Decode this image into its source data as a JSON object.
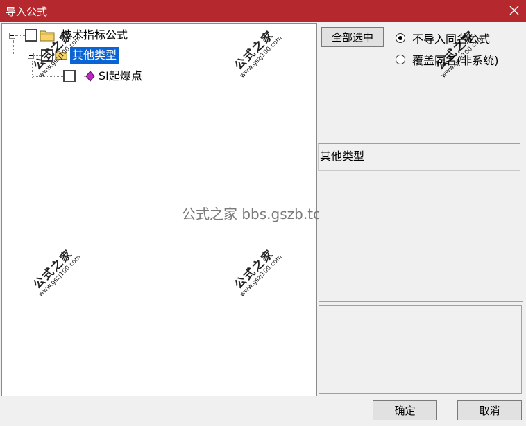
{
  "window": {
    "title": "导入公式",
    "close_icon": "close-icon",
    "titlebar_color": "#b5282d"
  },
  "tree": {
    "root": {
      "label": "技术指标公式",
      "checked": false,
      "expanded": true,
      "icon": "folder-icon"
    },
    "category": {
      "label": "其他类型",
      "checked": false,
      "expanded": true,
      "selected": true,
      "icon": "folder-icon"
    },
    "formula": {
      "label": "SI起爆点",
      "checked": false,
      "icon": "formula-icon"
    },
    "selection_color": "#0a64d6"
  },
  "options": {
    "select_all_label": "全部选中",
    "radio_no_import_label": "不导入同名公式",
    "radio_no_import_checked": true,
    "radio_overwrite_label": "覆盖同名(非系统)",
    "radio_overwrite_checked": false
  },
  "info": {
    "type_label": "其他类型"
  },
  "footer": {
    "ok_label": "确定",
    "cancel_label": "取消"
  },
  "watermark": {
    "center_text": "公式之家 bbs.gszb.top",
    "stamp_big": "公式之家",
    "stamp_small": "www.gszj100.com"
  }
}
